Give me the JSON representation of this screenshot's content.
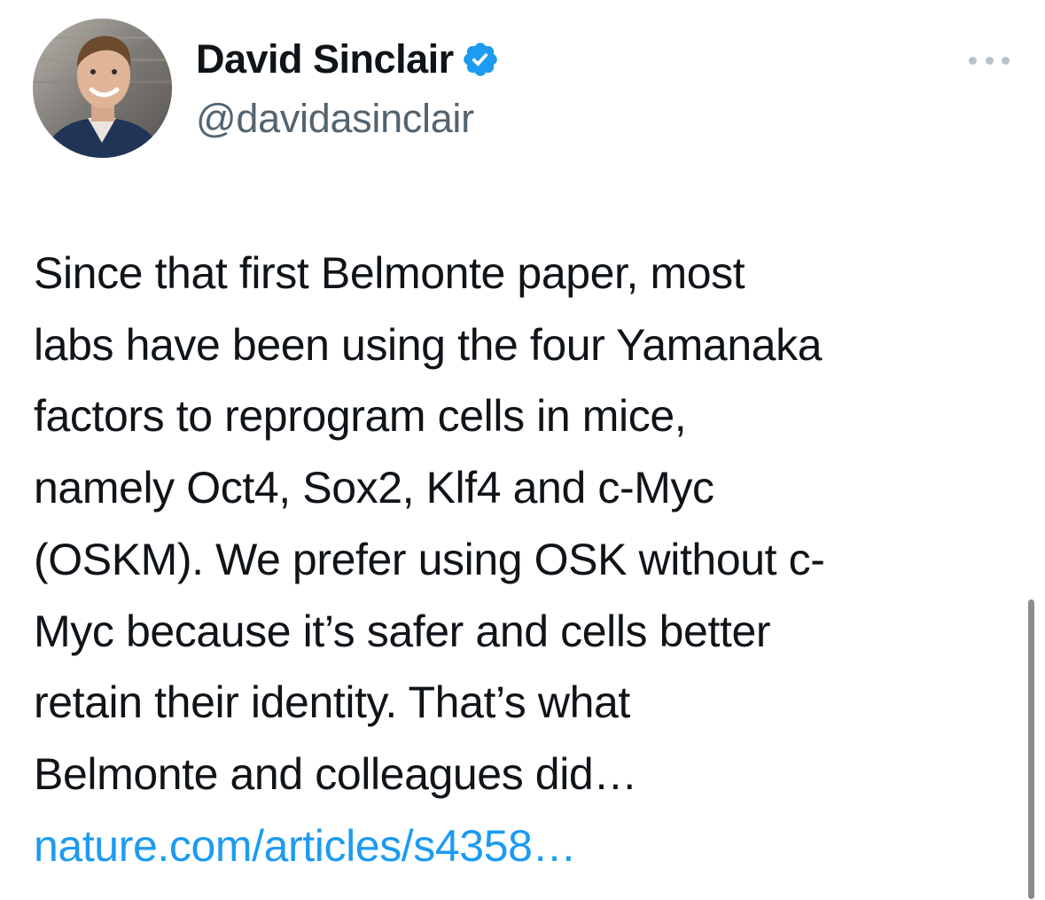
{
  "author": {
    "display_name": "David Sinclair",
    "handle": "@davidasinclair",
    "verified": true,
    "verified_badge_color": "#1d9bf0"
  },
  "menu": {
    "more_icon": "more-horizontal-icon"
  },
  "tweet": {
    "lines": [
      "Since that first Belmonte paper, most",
      "labs have been using the four Yamanaka",
      "factors to reprogram cells in mice,",
      "namely Oct4, Sox2, Klf4 and c-Myc",
      "(OSKM). We prefer using OSK without c-",
      "Myc because it’s safer and cells better",
      "retain their identity. That’s what",
      "Belmonte and colleagues did…"
    ],
    "link_text": "nature.com/articles/s4358…",
    "link_color": "#1d9bf0"
  },
  "colors": {
    "text": "#0f1419",
    "secondary": "#536471",
    "background": "#ffffff"
  }
}
